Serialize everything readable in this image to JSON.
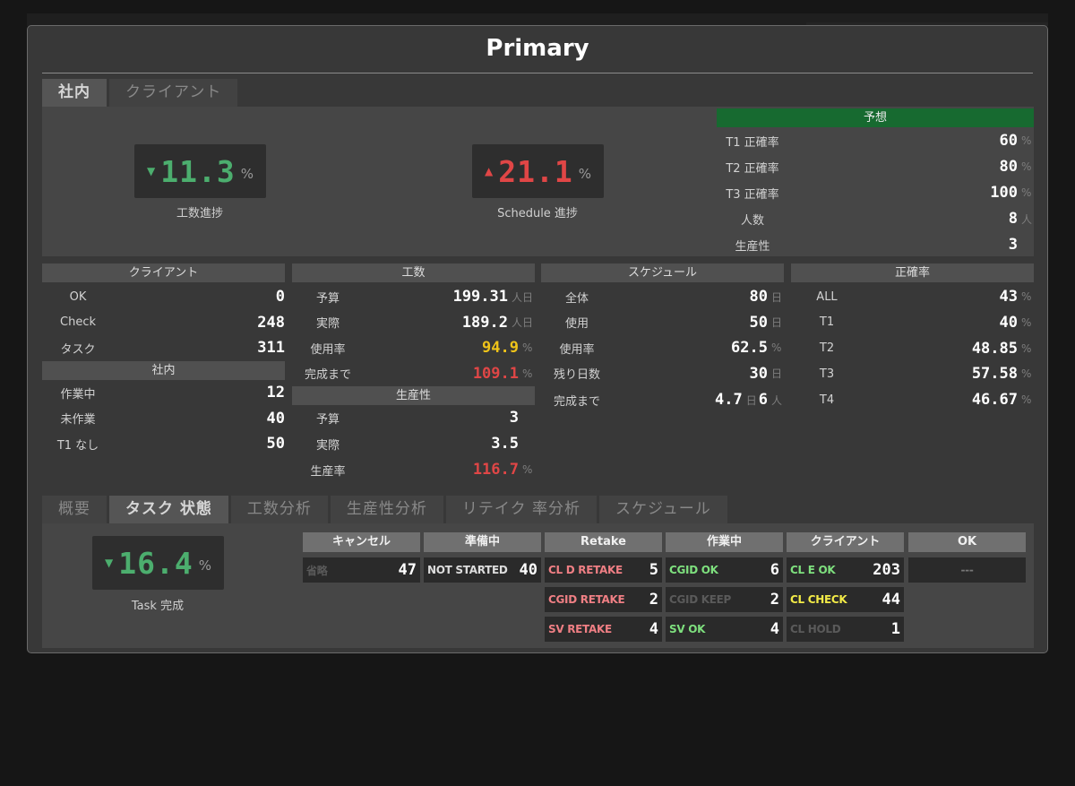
{
  "title": "Primary",
  "top_tabs": [
    "社内",
    "クライアント"
  ],
  "kpis": {
    "work_progress": {
      "value": "11.3",
      "unit": "%",
      "label": "工数進捗",
      "direction": "down",
      "color": "#4cae6e"
    },
    "schedule_progress": {
      "value": "21.1",
      "unit": "%",
      "label": "Schedule 進捗",
      "direction": "up",
      "color": "#e04646"
    }
  },
  "forecast": {
    "header": "予想",
    "rows": [
      {
        "label": "T1 正確率",
        "value": "60",
        "unit": "%"
      },
      {
        "label": "T2 正確率",
        "value": "80",
        "unit": "%"
      },
      {
        "label": "T3 正確率",
        "value": "100",
        "unit": "%"
      },
      {
        "label": "人数",
        "value": "8",
        "unit": "人"
      },
      {
        "label": "生産性",
        "value": "3",
        "unit": ""
      }
    ]
  },
  "client": {
    "header": "クライアント",
    "rows": [
      {
        "label": "OK",
        "value": "0"
      },
      {
        "label": "Check",
        "value": "248"
      },
      {
        "label": "タスク",
        "value": "311"
      }
    ]
  },
  "internal": {
    "header": "社内",
    "rows": [
      {
        "label": "作業中",
        "value": "12"
      },
      {
        "label": "未作業",
        "value": "40"
      },
      {
        "label": "T1 なし",
        "value": "50"
      }
    ]
  },
  "manhours": {
    "header": "工数",
    "rows": [
      {
        "label": "予算",
        "value": "199.31",
        "unit": "人日",
        "color": "#ffffff"
      },
      {
        "label": "実際",
        "value": "189.2",
        "unit": "人日",
        "color": "#ffffff"
      },
      {
        "label": "使用率",
        "value": "94.9",
        "unit": "%",
        "color": "#f0c419"
      },
      {
        "label": "完成まで",
        "value": "109.1",
        "unit": "%",
        "color": "#e04646"
      }
    ]
  },
  "productivity": {
    "header": "生産性",
    "rows": [
      {
        "label": "予算",
        "value": "3",
        "unit": "",
        "color": "#ffffff"
      },
      {
        "label": "実際",
        "value": "3.5",
        "unit": "",
        "color": "#ffffff"
      },
      {
        "label": "生産率",
        "value": "116.7",
        "unit": "%",
        "color": "#e04646"
      }
    ]
  },
  "schedule": {
    "header": "スケジュール",
    "rows": [
      {
        "label": "全体",
        "value": "80",
        "unit": "日"
      },
      {
        "label": "使用",
        "value": "50",
        "unit": "日"
      },
      {
        "label": "使用率",
        "value": "62.5",
        "unit": "%"
      },
      {
        "label": "残り日数",
        "value": "30",
        "unit": "日"
      }
    ],
    "completion": {
      "label": "完成まで",
      "value1": "4.7",
      "unit1": "日",
      "value2": "6",
      "unit2": "人"
    }
  },
  "accuracy": {
    "header": "正確率",
    "rows": [
      {
        "label": "ALL",
        "value": "43",
        "unit": "%"
      },
      {
        "label": "T1",
        "value": "40",
        "unit": "%"
      },
      {
        "label": "T2",
        "value": "48.85",
        "unit": "%"
      },
      {
        "label": "T3",
        "value": "57.58",
        "unit": "%"
      },
      {
        "label": "T4",
        "value": "46.67",
        "unit": "%"
      }
    ]
  },
  "bottom_tabs": [
    "概要",
    "タスク 状態",
    "工数分析",
    "生産性分析",
    "リテイク 率分析",
    "スケジュール"
  ],
  "bottom_active_tab": 1,
  "task_completion": {
    "value": "16.4",
    "unit": "%",
    "label": "Task 完成",
    "direction": "down",
    "color": "#4cae6e"
  },
  "status_groups": [
    {
      "header": "キャンセル",
      "items": [
        {
          "label": "省略",
          "value": "47",
          "color": "#5a5a5a"
        }
      ]
    },
    {
      "header": "準備中",
      "items": [
        {
          "label": "NOT STARTED",
          "value": "40",
          "color": "#dddddd"
        }
      ]
    },
    {
      "header": "Retake",
      "items": [
        {
          "label": "CL D RETAKE",
          "value": "5",
          "color": "#ef7f84"
        },
        {
          "label": "CGID RETAKE",
          "value": "2",
          "color": "#ef7f84"
        },
        {
          "label": "SV RETAKE",
          "value": "4",
          "color": "#ef7f84"
        }
      ]
    },
    {
      "header": "作業中",
      "items": [
        {
          "label": "CGID OK",
          "value": "6",
          "color": "#7ee07e"
        },
        {
          "label": "CGID KEEP",
          "value": "2",
          "color": "#5a5a5a"
        },
        {
          "label": "SV OK",
          "value": "4",
          "color": "#7ee07e"
        }
      ]
    },
    {
      "header": "クライアント",
      "items": [
        {
          "label": "CL E OK",
          "value": "203",
          "color": "#7ee07e"
        },
        {
          "label": "CL CHECK",
          "value": "44",
          "color": "#f2ea47"
        },
        {
          "label": "CL HOLD",
          "value": "1",
          "color": "#5a5a5a"
        }
      ]
    },
    {
      "header": "OK",
      "items": [
        {
          "label": "---",
          "value": "",
          "color": "#777777"
        }
      ]
    }
  ]
}
